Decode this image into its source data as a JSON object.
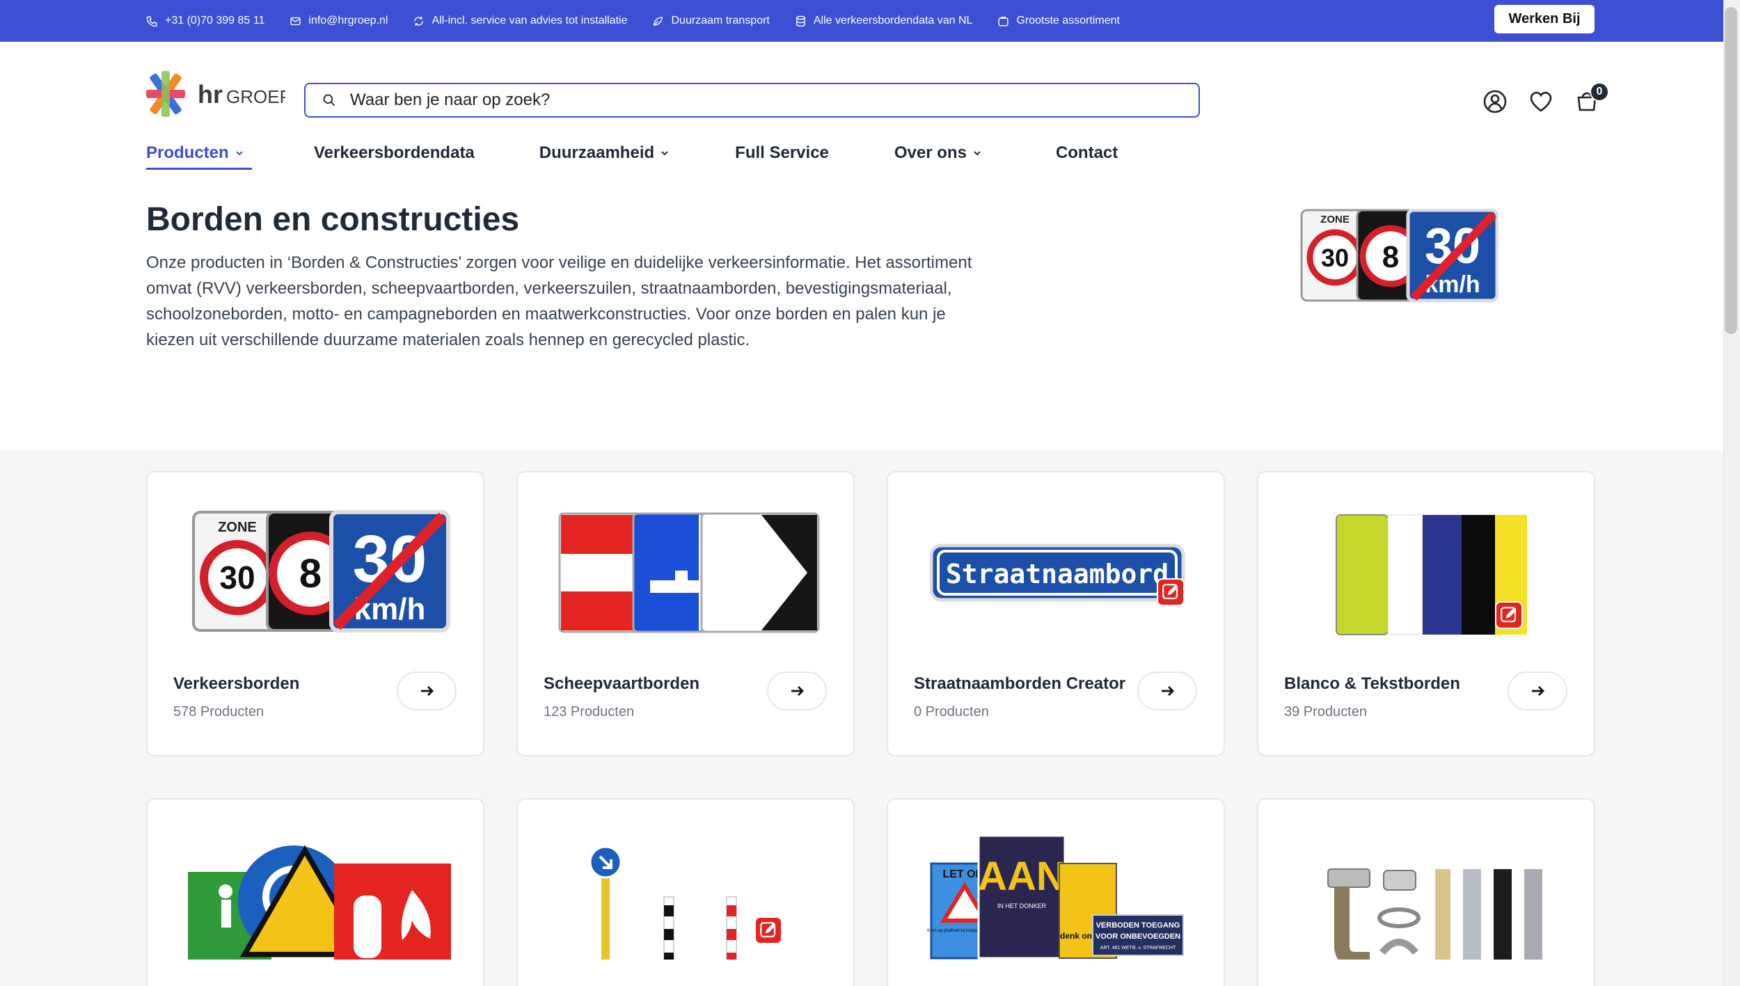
{
  "topbar": {
    "items": [
      {
        "icon": "phone-icon",
        "label": "+31 (0)70 399 85 11"
      },
      {
        "icon": "mail-icon",
        "label": "info@hrgroep.nl"
      },
      {
        "icon": "refresh-icon",
        "label": "All-incl. service van advies tot installatie"
      },
      {
        "icon": "leaf-icon",
        "label": "Duurzaam transport"
      },
      {
        "icon": "database-icon",
        "label": "Alle verkeersbordendata van NL"
      },
      {
        "icon": "box-icon",
        "label": "Grootste assortiment"
      }
    ],
    "cta": "Werken Bij",
    "color": "#3d4fd3"
  },
  "logo": {
    "text_hr": "hr",
    "text_groep": "GROEP"
  },
  "search": {
    "placeholder": "Waar ben je naar op zoek?"
  },
  "header": {
    "cart_count": "0"
  },
  "nav": {
    "items": [
      {
        "label": "Producten",
        "dropdown": true,
        "active": true
      },
      {
        "label": "Verkeersbordendata",
        "dropdown": false
      },
      {
        "label": "Duurzaamheid",
        "dropdown": true
      },
      {
        "label": "Full Service",
        "dropdown": false
      },
      {
        "label": "Over ons",
        "dropdown": true
      },
      {
        "label": "Contact",
        "dropdown": false
      }
    ]
  },
  "hero": {
    "title": "Borden en constructies",
    "text": "Onze producten in ‘Borden & Constructies’ zorgen voor veilige en duidelijke verkeersinformatie. Het assortiment omvat (RVV) verkeersborden, scheepvaartborden, verkeerszuilen, straatnaamborden, bevestigingsmateriaal, schoolzoneborden, motto- en campagneborden en maatwerkconstructies. Voor onze borden en palen kun je kiezen uit verschillende duurzame materialen zoals hennep en gerecycled plastic.",
    "sign": {
      "zone": "ZONE",
      "speed": "30",
      "number": "8",
      "end_speed": "30",
      "unit": "km/h"
    }
  },
  "cards": [
    {
      "name": "Verkeersborden",
      "count": "578 Producten"
    },
    {
      "name": "Scheepvaartborden",
      "count": "123 Producten"
    },
    {
      "name": "Straatnaamborden Creator",
      "count": "0 Producten"
    },
    {
      "name": "Blanco & Tekstborden",
      "count": "39 Producten"
    }
  ],
  "card_art": {
    "streetname": "Straatnaambord",
    "campaign": {
      "let_op": "LET OP!",
      "glad": "Kans op gladheid bij knipperende lichten",
      "aan": "AAN",
      "donker": "IN HET DONKER",
      "denk": "denk onz kind",
      "verboden1": "VERBODEN TOEGANG",
      "verboden2": "VOOR ONBEVOEGDEN",
      "art": "ART. 461 WETB. v. STRAFRECHT"
    }
  }
}
